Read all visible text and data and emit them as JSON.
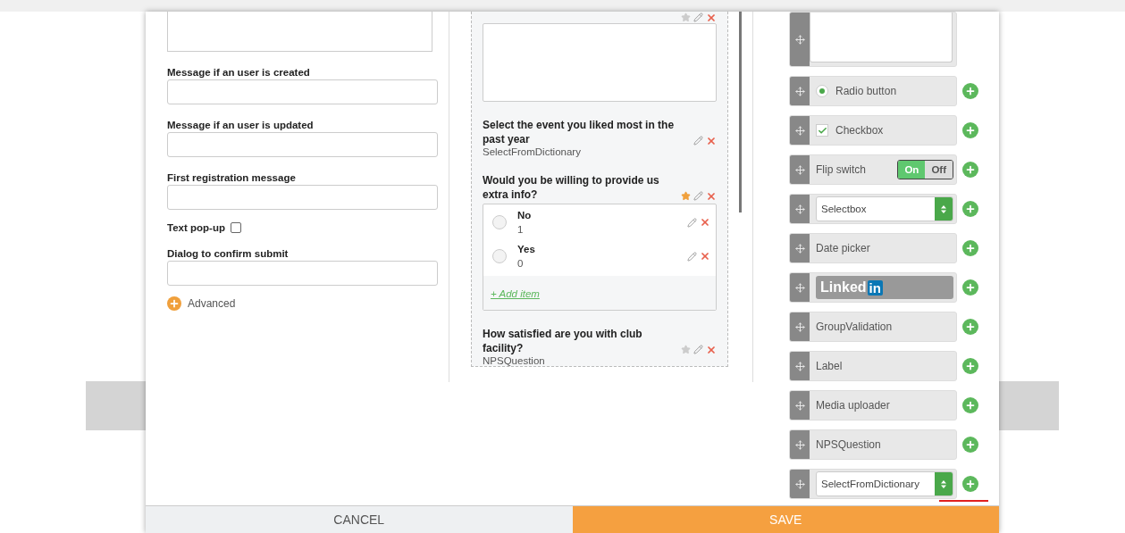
{
  "form_settings": {
    "fields": [
      {
        "kind": "textarea"
      },
      {
        "kind": "input",
        "label": "Message if an user is created"
      },
      {
        "kind": "input",
        "label": "Message if an user is updated"
      },
      {
        "kind": "input",
        "label": "First registration message"
      },
      {
        "kind": "checkbox",
        "label": "Text pop-up",
        "checked": false
      },
      {
        "kind": "input",
        "label": "Dialog to confirm submit"
      }
    ],
    "advanced": "Advanced"
  },
  "questions": [
    {
      "kind": "textarea",
      "starred": false
    },
    {
      "kind": "question",
      "title": "Select the event you liked most in the past year",
      "type": "SelectFromDictionary"
    },
    {
      "kind": "options",
      "title": "Would you be willing to provide us extra info?",
      "starred": true,
      "options": [
        {
          "label": "No",
          "value": "1",
          "selected": false
        },
        {
          "label": "Yes",
          "value": "0",
          "selected": false
        }
      ],
      "add_item": "+ Add item"
    },
    {
      "kind": "question",
      "title": "How satisfied are you with club facility?",
      "type": "NPSQuestion",
      "starred": false
    }
  ],
  "palette": [
    {
      "kind": "textarea"
    },
    {
      "kind": "radio",
      "label": "Radio button",
      "selected": true
    },
    {
      "kind": "checkbox",
      "label": "Checkbox",
      "checked": true
    },
    {
      "kind": "flip",
      "label": "Flip switch",
      "on_label": "On",
      "off_label": "Off",
      "on": true
    },
    {
      "kind": "select",
      "label": "Selectbox"
    },
    {
      "kind": "plain",
      "label": "Date picker"
    },
    {
      "kind": "linkedin",
      "label": "Linked",
      "badge": "in"
    },
    {
      "kind": "plain",
      "label": "GroupValidation"
    },
    {
      "kind": "plain",
      "label": "Label"
    },
    {
      "kind": "plain",
      "label": "Media uploader"
    },
    {
      "kind": "plain",
      "label": "NPSQuestion"
    },
    {
      "kind": "select",
      "label": "SelectFromDictionary",
      "highlighted": true
    }
  ],
  "buttons": [
    {
      "kind": "cancel",
      "label": "CANCEL"
    },
    {
      "kind": "save",
      "label": "SAVE"
    }
  ]
}
